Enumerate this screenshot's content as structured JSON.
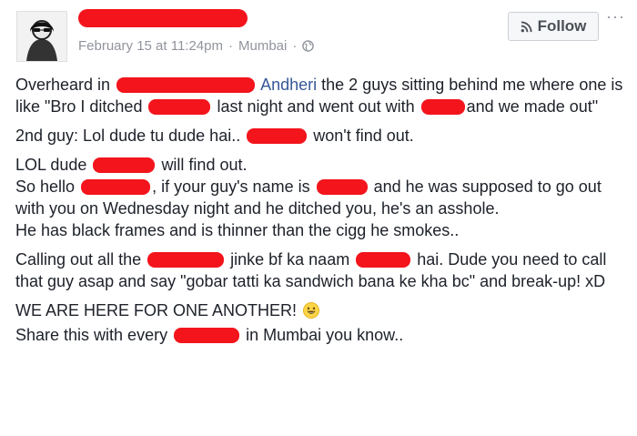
{
  "header": {
    "date": "February 15 at 11:24pm",
    "separator": "·",
    "location": "Mumbai",
    "separator2": "·",
    "privacy_icon": "globe-icon"
  },
  "actions": {
    "follow_label": "Follow",
    "follow_icon": "rss-icon",
    "more_label": "···"
  },
  "post": {
    "p1": {
      "a": "Overheard in",
      "place": "Andheri",
      "b": "the 2 guys sitting behind me where one is like \"Bro I ditched",
      "c": "last night and went out with",
      "d": "and we made out\""
    },
    "p2": {
      "a": "2nd guy: Lol dude tu dude hai..",
      "b": "won't find out."
    },
    "p3": {
      "a": "LOL dude",
      "b": "will find out.",
      "c": "So hello",
      "d": ", if your guy's name is",
      "e": "and he was supposed to go out with you on Wednesday night and he ditched you, he's an asshole.",
      "f": "He has black frames and is thinner than the cigg he smokes.."
    },
    "p4": {
      "a": "Calling out all the",
      "b": "jinke bf ka naam",
      "c": "hai. Dude you need to call that guy asap and say \"gobar tatti ka sandwich bana ke kha bc\" and break-up! xD"
    },
    "p5": {
      "a": "WE ARE HERE FOR ONE ANOTHER!",
      "emoji": "smiley-emoji",
      "b": "Share this with every",
      "c": "in Mumbai you know.."
    }
  },
  "colors": {
    "redaction": "#f3141c",
    "link": "#365899",
    "text": "#1d2129",
    "meta": "#90949c"
  }
}
